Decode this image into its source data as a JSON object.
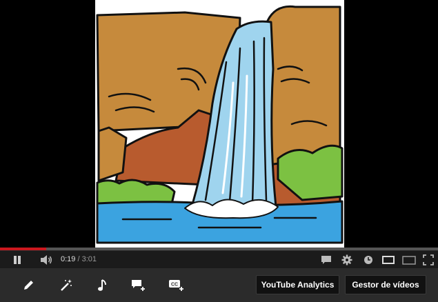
{
  "player": {
    "current_time": "0:19",
    "separator": " / ",
    "duration": "3:01",
    "progress_fraction": 0.105
  },
  "toolbar": {
    "analytics_label": "YouTube Analytics",
    "manager_label": "Gestor de vídeos"
  },
  "icons": {
    "pause": "pause-icon",
    "volume": "volume-icon",
    "annotations": "annotations-icon",
    "settings": "gear-icon",
    "watch_later": "clock-icon",
    "small_player": "small-player-icon",
    "large_player": "large-player-icon",
    "fullscreen": "fullscreen-icon",
    "edit": "pencil-icon",
    "enhance": "magic-wand-icon",
    "audio": "music-note-icon",
    "add_annotation": "add-annotation-icon",
    "add_captions": "add-captions-icon"
  },
  "colors": {
    "progress_played": "#cc181e",
    "toolbar_bg": "#2b2b2b"
  }
}
